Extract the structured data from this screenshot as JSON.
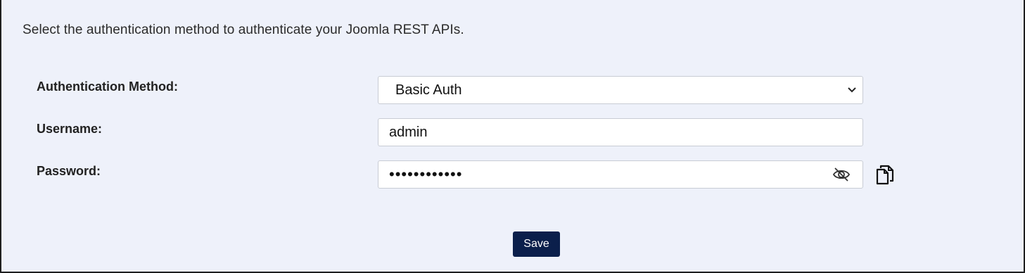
{
  "intro": {
    "text": "Select the authentication method to authenticate your Joomla REST APIs."
  },
  "form": {
    "auth_method": {
      "label": "Authentication Method:",
      "selected": "Basic Auth"
    },
    "username": {
      "label": "Username:",
      "value": "admin"
    },
    "password": {
      "label": "Password:",
      "value": "••••••••••••"
    }
  },
  "icons": {
    "toggle_visibility": "eye-slash-icon",
    "copy": "copy-icon",
    "dropdown": "chevron-down-icon"
  },
  "actions": {
    "save_label": "Save"
  },
  "colors": {
    "background": "#eef1fa",
    "button": "#0b1f4b",
    "button_text": "#ffffff"
  }
}
